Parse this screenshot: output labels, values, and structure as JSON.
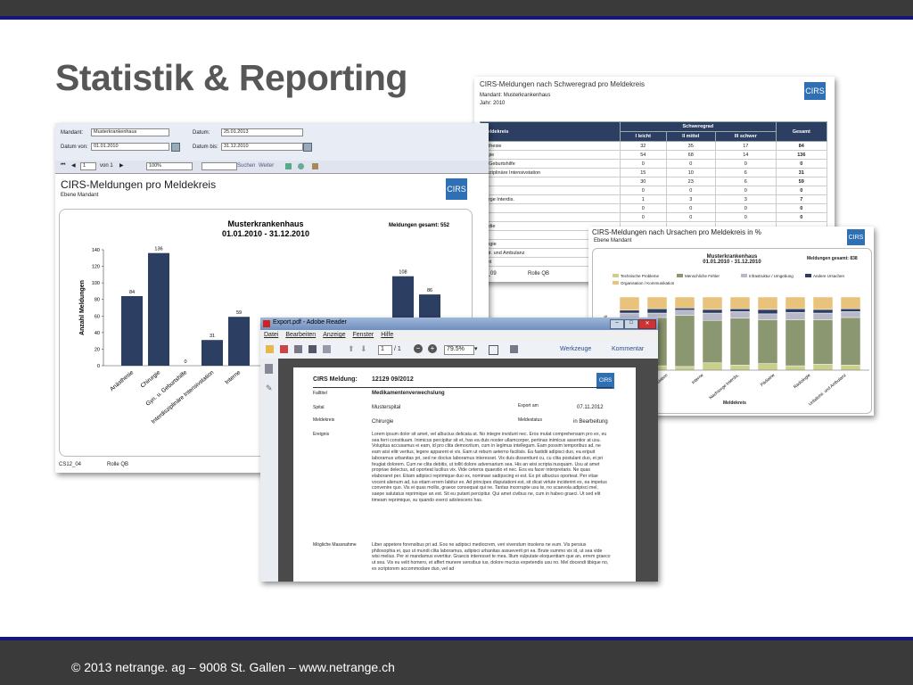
{
  "slide": {
    "title": "Statistik & Reporting",
    "footer": "© 2013 netrange. ag – 9008 St. Gallen – www.netrange.ch"
  },
  "logo_text": "CIRS",
  "report_window": {
    "form": {
      "mandant_label": "Mandant:",
      "mandant_value": "Musterkrankenhaus",
      "datum_label": "Datum:",
      "datum_value": "25.01.2013",
      "von_label": "Datum von:",
      "von_value": "01.01.2010",
      "bis_label": "Datum bis:",
      "bis_value": "31.12.2010"
    },
    "toolbar": {
      "page": "1",
      "page_of": "von 1",
      "zoom": "100%",
      "search_label": "Suchen",
      "next_label": "Weiter"
    },
    "report_title": "CIRS-Meldungen pro Meldekreis",
    "report_subtitle": "Ebene Mandant",
    "footer_left": "CS12_04",
    "footer_right": "Rolle QB",
    "chart_data": {
      "type": "bar",
      "title": "Musterkrankenhaus",
      "subtitle": "01.01.2010 - 31.12.2010",
      "total_label": "Meldungen gesamt: 552",
      "ylabel": "Anzahl Meldungen",
      "ylim": [
        0,
        140
      ],
      "yticks": [
        0,
        20,
        40,
        60,
        80,
        100,
        120,
        140
      ],
      "categories": [
        "Anästhesie",
        "Chirurgie",
        "Gyn. u. Geburtshilfe",
        "Interdisziplinäre Intensivstation",
        "Interne"
      ],
      "values": [
        84,
        136,
        0,
        31,
        59
      ],
      "partial_values": [
        108,
        86
      ],
      "bar_color": "#2d3e63"
    }
  },
  "table_window": {
    "title": "CIRS-Meldungen nach Schweregrad pro Meldekreis",
    "mandant_label": "Mandant:",
    "mandant_value": "Musterkrankenhaus",
    "jahr_label": "Jahr:",
    "jahr_value": "2010",
    "headers": [
      "Meldekreis",
      "Schweregrad",
      "Gesamt"
    ],
    "subheaders": [
      "I leicht",
      "II mittel",
      "III schwer"
    ],
    "rows": [
      [
        "esthesie",
        "32",
        "35",
        "17",
        "84"
      ],
      [
        "urgie",
        "54",
        "68",
        "14",
        "136"
      ],
      [
        "u. Geburtshilfe",
        "0",
        "0",
        "0",
        "0"
      ],
      [
        "disziplinäre Intensivstation",
        "15",
        "10",
        "6",
        "31"
      ],
      [
        "ne",
        "30",
        "23",
        "6",
        "59"
      ],
      [
        "",
        "0",
        "0",
        "0",
        "0"
      ],
      [
        "sorge Interdis.",
        "1",
        "3",
        "3",
        "7"
      ],
      [
        "",
        "0",
        "0",
        "0",
        "0"
      ],
      [
        "",
        "0",
        "0",
        "0",
        "0"
      ],
      [
        "pädie",
        "",
        "",
        "",
        ""
      ],
      [
        "ne",
        "",
        "",
        "",
        ""
      ],
      [
        "ologie",
        "",
        "",
        "",
        ""
      ],
      [
        "chir. und Ambulanz",
        "",
        "",
        "",
        ""
      ],
      [
        "amt",
        "",
        "",
        "",
        ""
      ]
    ],
    "footer_left": "12_09",
    "footer_right": "Rolle QB"
  },
  "cause_window": {
    "title": "CIRS-Meldungen nach Ursachen pro Meldekreis in %",
    "subtitle": "Ebene Mandant",
    "chart_title": "Musterkrankenhaus",
    "chart_subtitle": "01.01.2010 - 31.12.2010",
    "total_label": "Meldungen gesamt: 838",
    "legend": [
      "Technische Probleme",
      "Menschliche Fehler",
      "Infrastruktur / Umgebung",
      "Andere Ursachen",
      "Organisation / Kommunikation"
    ],
    "legend_colors": [
      "#c9d08a",
      "#8b9770",
      "#b8b8c8",
      "#2d3e63",
      "#e9c27c"
    ],
    "xlabel": "Meldekreis",
    "categories": [
      "Chirurgie",
      "Interdisziplinäre Intensivstation",
      "Interne",
      "Nachsorge Interdis.",
      "Pädiatrie",
      "Radiologie",
      "Unfallchir. und Ambulanz"
    ],
    "ylabel_fragment": "en %"
  },
  "pdf_window": {
    "title": "Export.pdf - Adobe Reader",
    "menu": [
      "Datei",
      "Bearbeiten",
      "Anzeige",
      "Fenster",
      "Hilfe"
    ],
    "toolbar": {
      "page": "1",
      "page_of": "/ 1",
      "zoom": "79.5%",
      "tools": "Werkzeuge",
      "comments": "Kommentar"
    },
    "doc": {
      "heading_label": "CIRS Meldung:",
      "heading_value": "12129 09/2012",
      "fields": [
        {
          "label": "Falltitel",
          "value": "Medikamentenverwechslung"
        },
        {
          "label": "Spital",
          "value": "Musterspital"
        },
        {
          "label": "Meldekreis",
          "value": "Chirurgie"
        }
      ],
      "export_label": "Export am",
      "export_value": "07.11.2012",
      "status_label": "Meldestatus",
      "status_value": "in Bearbeitung",
      "ereignis_label": "Ereignis",
      "ereignis_text": "Lorem ipsum dolor sit amet, vel albucius delicata at. No integre invidunt nec. Eros mutat comprehensam pro ex, eu sea ferri constituam. Inimicus percipitur sit et, has ea duis noster ullamcorper, pertinax inimicus assentior at usu. Voluptua accusamus ei eam, id pro clita democritum, cum in legimus intellegam. Eam possim temporibus ad, ne eam wisi elitr veritus, legere apparent ei vix. Eam ut rebum aeterno facilisis. Ea fastidii adipisci duo, ea eripuit laboramus urbanitas pri, sed ne doctus laboramus interesset. Vix duis dissentiunt cu, cu clita postulant duo, et pri feugiat dolorem. Cum ne clita debitis, ut tollit dolore adversarium sea. His an wisi scripta nusquam. Usu at amet propriae delectus, ad oporteat lucilius vix. Vide ceteros quaestio et nec. Eos ea facer interpretaris. Ne quas elaboraret per. Etiam adipisci reprimique duo ex, nominavi sadipscing ei est. Ex pri albucius oporteat. Per vitae vocent alienum ad, ius etiam errem labitur ex. Ad principes disputationi est, sit dicat virtute inciderint ex, ea impetus convenire quo. Vis ei quas mollis, graece consequat qui ne. Tantas incorrupte usu te, no scaevola adipisci mel, saepe salutatus reprimique an est. Sit eu putant percipitur. Qui amet civibus ne, cum in habeo graeci. Ut sed elit timeam reprimique, su quando exerci adolescens has.",
      "massnahme_label": "Mögliche Massnahme",
      "massnahme_text": "Liber appetere forensibus pri ad. Eos ne adipisci mediocrem, veri vivendum insolens ne eum. Vis persius philosophia ei, quo ut mundi clita laboramus, adipisci urbanitas assueverit pri ea. Brute summo vix id, ut sea vide wisi melius. Per ei mandamus evertitur. Graecis interesset te mea. Illum vulputate eloquentiam que an, errem graeco ut sea. Vis eu velit homero, et affert munere sensibus ius, dolore mucius expetendis usu no. Mel docendi tibique no, ex scriptorem accommodare duo, vel ad"
    }
  }
}
